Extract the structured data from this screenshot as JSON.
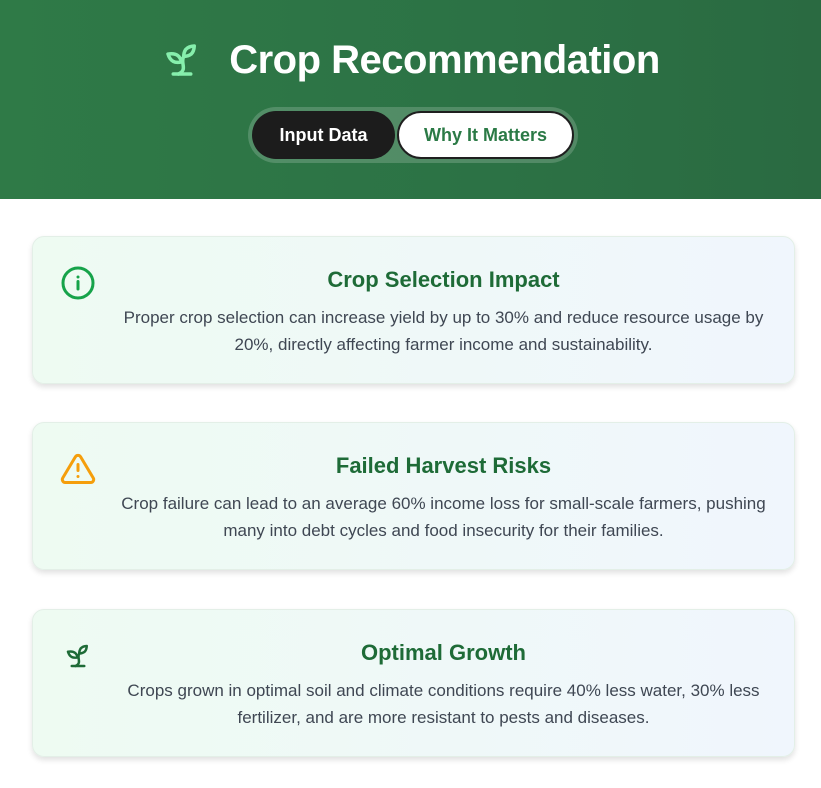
{
  "header": {
    "logo_icon": "sprout-icon",
    "title": "Crop Recommendation",
    "tabs": [
      {
        "label": "Input Data",
        "active": true
      },
      {
        "label": "Why It Matters",
        "active": false
      }
    ]
  },
  "cards": [
    {
      "icon": "info-circle-icon",
      "icon_color": "#16a34a",
      "title": "Crop Selection Impact",
      "text": "Proper crop selection can increase yield by up to 30% and reduce resource usage by 20%, directly affecting farmer income and sustainability."
    },
    {
      "icon": "warning-triangle-icon",
      "icon_color": "#f59e0b",
      "title": "Failed Harvest Risks",
      "text": "Crop failure can lead to an average 60% income loss for small-scale farmers, pushing many into debt cycles and food insecurity for their families."
    },
    {
      "icon": "sprout-icon",
      "icon_color": "#1e6b37",
      "title": "Optimal Growth",
      "text": "Crops grown in optimal soil and climate conditions require 40% less water, 30% less fertilizer, and are more resistant to pests and diseases."
    }
  ],
  "colors": {
    "header_bg": "#2c7245",
    "accent": "#2b7a46",
    "title_green": "#1e6b37",
    "active_tab_bg": "#1c1c1c"
  }
}
